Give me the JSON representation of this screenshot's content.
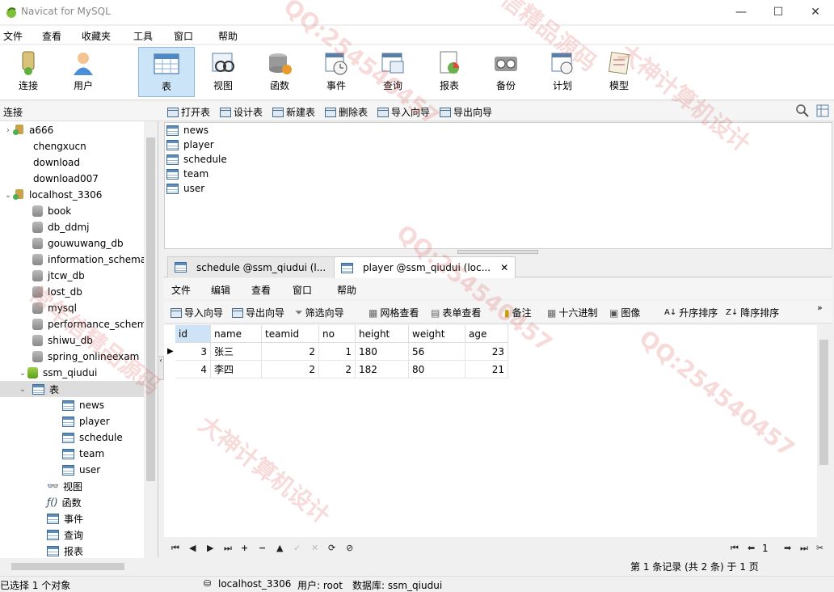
{
  "window": {
    "title": "Navicat for MySQL",
    "minimize": "—",
    "maximize": "☐",
    "close": "✕"
  },
  "menubar": [
    "文件",
    "查看",
    "收藏夹",
    "工具",
    "窗口",
    "帮助"
  ],
  "toolbar": [
    {
      "label": "连接",
      "icon": "connection-icon"
    },
    {
      "label": "用户",
      "icon": "user-icon"
    },
    {
      "label": "表",
      "icon": "table-icon",
      "active": true
    },
    {
      "label": "视图",
      "icon": "view-icon"
    },
    {
      "label": "函数",
      "icon": "function-icon"
    },
    {
      "label": "事件",
      "icon": "event-icon"
    },
    {
      "label": "查询",
      "icon": "query-icon"
    },
    {
      "label": "报表",
      "icon": "report-icon"
    },
    {
      "label": "备份",
      "icon": "backup-icon"
    },
    {
      "label": "计划",
      "icon": "schedule-icon"
    },
    {
      "label": "模型",
      "icon": "model-icon"
    }
  ],
  "connection_label": "连接",
  "objbar": [
    "打开表",
    "设计表",
    "新建表",
    "删除表",
    "导入向导",
    "导出向导"
  ],
  "tree": {
    "connections_top": [
      "a666",
      "chengxucn",
      "download",
      "download007"
    ],
    "localhost": "localhost_3306",
    "databases": [
      "book",
      "db_ddmj",
      "gouwuwang_db",
      "information_schema",
      "jtcw_db",
      "lost_db",
      "mysql",
      "performance_schem",
      "shiwu_db",
      "spring_onlineexam"
    ],
    "open_db": "ssm_qiudui",
    "tables_node": "表",
    "tables": [
      "news",
      "player",
      "schedule",
      "team",
      "user"
    ],
    "other_nodes": [
      "视图",
      "函数",
      "事件",
      "查询",
      "报表"
    ]
  },
  "tablelist": [
    "news",
    "player",
    "schedule",
    "team",
    "user"
  ],
  "tabs": [
    {
      "label": "schedule @ssm_qiudui (l...",
      "active": false
    },
    {
      "label": "player @ssm_qiudui (loc...",
      "active": true
    }
  ],
  "inner_menu": [
    "文件",
    "编辑",
    "查看",
    "窗口",
    "帮助"
  ],
  "inner_tools": [
    "导入向导",
    "导出向导",
    "筛选向导",
    "网格查看",
    "表单查看",
    "备注",
    "十六进制",
    "图像",
    "升序排序",
    "降序排序"
  ],
  "grid": {
    "columns": [
      "id",
      "name",
      "teamid",
      "no",
      "height",
      "weight",
      "age"
    ],
    "rows": [
      [
        "3",
        "张三",
        "2",
        "1",
        "180",
        "56",
        "23"
      ],
      [
        "4",
        "李四",
        "2",
        "2",
        "182",
        "80",
        "21"
      ]
    ]
  },
  "nav": {
    "page": "1",
    "record_info": "第 1 条记录 (共 2 条) 于 1 页"
  },
  "status": {
    "selected": "已选择 1 个对象",
    "connection": "localhost_3306",
    "user": "用户: root",
    "database": "数据库: ssm_qiudui"
  },
  "watermarks": [
    "QQ:254540457",
    "常年信精品源码",
    "大神计算机设计"
  ]
}
